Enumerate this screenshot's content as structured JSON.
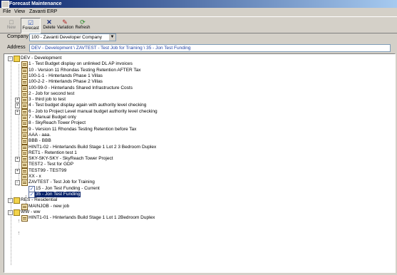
{
  "window": {
    "title": "Forecast Maintenance"
  },
  "menu": {
    "file": "File",
    "view": "View",
    "erp": "Zavanti ERP"
  },
  "toolbar": {
    "new": "New",
    "forecast": "Forecast",
    "delete": "Delete",
    "variation": "Variation",
    "refresh": "Refresh"
  },
  "company": {
    "label": "Company",
    "value": "100 - Zavanti Developer Company"
  },
  "address": {
    "label": "Address",
    "value": "DEV - Development \\ ZAVTEST - Test Job for Training \\ 35 - Jon Test Funding"
  },
  "tree": {
    "dev": "DEV - Development",
    "dev_children": [
      "1 - Test Budget display on unlinked DL AP invoices",
      "10 - Version 11 Rhondas Testing Retention AFTER Tax",
      "100-1-1 - Hinterlands Phase 1 Villas",
      "100-2-2 - Hinterlands Phase 2 Villas",
      "100-99-0 - Hinterlands Shared Infrastructure Costs",
      "2 - Job for second test",
      "3 - third job to test",
      "4 - Test budget display again with authority level checking",
      "6 - Job to Project Level manual budget authority level checking",
      "7 - Manual Budget only",
      "8 - SkyReach Tower Project",
      "9 - Version 11 Rhondas Testing Retention before Tax",
      "AAA - aaa.",
      "BBB - BBB",
      "HINT1-02 - Hinterlands Build Stage 1 Lot 2 3 Bedroom Duplex",
      "RET1 - Retention test 1",
      "SKY-SKY-SKY - SkyReach Tower Project",
      "TEST2 - Test for GDP",
      "TEST99 - TEST99",
      "XX - x",
      "ZAVTEST - Test Job for Training"
    ],
    "zavtest_children": [
      "15 - Jon Test Funding - Current",
      "35 - Jon Test Funding"
    ],
    "res": "RES - Residential",
    "res_children": [
      "MAINJOB - new job"
    ],
    "ww": "WW - ww",
    "ww_children": [
      "HINT1-01 - Hinterlands Build Stage 1 Lot 1 2Bedroom Duplex"
    ]
  },
  "colors": {
    "selection": "#0a246a",
    "title_bar": "#0a246a",
    "address_text": "#1f3fa3"
  }
}
